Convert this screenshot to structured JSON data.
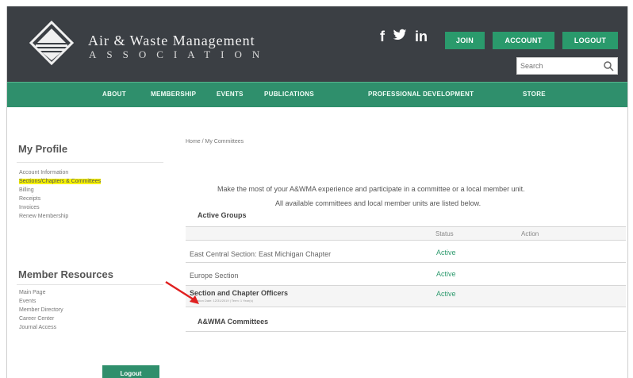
{
  "header": {
    "org_name": "Air & Waste Management",
    "org_sub": "ASSOCIATION",
    "social": [
      "f",
      "𝕏",
      "in"
    ],
    "social_icons": [
      "facebook-icon",
      "twitter-icon",
      "linkedin-icon"
    ],
    "buttons": {
      "join": "JOIN",
      "account": "ACCOUNT",
      "logout": "LOGOUT"
    },
    "search": {
      "placeholder": "Search"
    },
    "colors": {
      "header_bg": "#3b3f44",
      "accent": "#2a9a6c"
    }
  },
  "nav": {
    "items": [
      "ABOUT",
      "MEMBERSHIP",
      "EVENTS",
      "PUBLICATIONS",
      "PROFESSIONAL DEVELOPMENT",
      "STORE"
    ]
  },
  "sidebar": {
    "profile_heading": "My Profile",
    "profile_links": [
      "Account Information",
      "Sections/Chapters & Committees",
      "Billing",
      "Receipts",
      "Invoices",
      "Renew Membership"
    ],
    "resources_heading": "Member Resources",
    "resource_links": [
      "Main Page",
      "Events",
      "Member Directory",
      "Career Center",
      "Journal Access"
    ],
    "logout_label": "Logout"
  },
  "main": {
    "breadcrumb": "Home / My Committees",
    "intro_line1": "Make the most of your A&WMA experience and participate in a committee or a local member unit.",
    "intro_line2": "All available committees and local member units are listed below.",
    "active_groups_title": "Active Groups",
    "table_headers": {
      "status": "Status",
      "action": "Action"
    },
    "rows": [
      {
        "name": "East Central Section: East Michigan Chapter",
        "sub": "",
        "status": "Active"
      },
      {
        "name": "Europe Section",
        "sub": "",
        "status": "Active"
      },
      {
        "name": "Section and Chapter Officers",
        "sub": "Expiration Date: 12/31/2019 | Term: 1 Year(s)",
        "status": "Active"
      }
    ],
    "committees_title": "A&WMA Committees"
  }
}
